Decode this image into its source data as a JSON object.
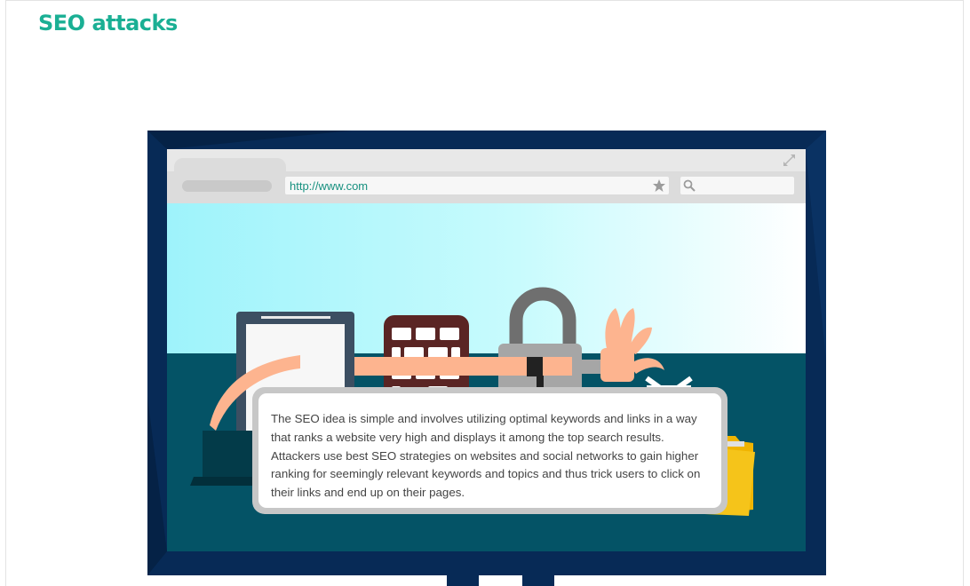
{
  "page": {
    "title": "SEO attacks"
  },
  "browser": {
    "url": "http://www.com",
    "icons": [
      "expand-icon",
      "star-icon",
      "search-icon"
    ]
  },
  "popup": {
    "text": "The SEO idea is simple and involves utilizing optimal keywords and links in a way that ranks a website very high and displays it among the top search results. Attackers use best SEO strategies on websites and social networks to gain higher ranking for seemingly relevant keywords and topics and thus trick users to click on their links and end up on their pages."
  },
  "colors": {
    "title": "#1aaf94",
    "monitor_frame": "#072a56",
    "desk": "#045366",
    "sky_start": "#9ef3fb",
    "url_text": "#17907f",
    "arm": "#fdb48f",
    "popup_border": "#c7c7c7",
    "popup_text": "#444444"
  }
}
